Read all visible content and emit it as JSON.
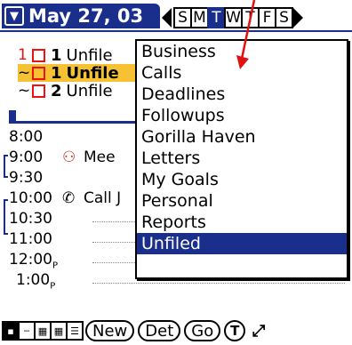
{
  "header": {
    "date": "May 27, 03",
    "week_days": [
      "S",
      "M",
      "T",
      "W",
      "T",
      "F",
      "S"
    ],
    "selected_day_index": 2
  },
  "todos": [
    {
      "priority": "1",
      "count": "1",
      "text": "Unfile",
      "highlighted": false
    },
    {
      "priority": "~",
      "count": "1",
      "text": "Unfile",
      "highlighted": true
    },
    {
      "priority": "~",
      "count": "2",
      "text": "Unfile",
      "highlighted": false
    }
  ],
  "schedule": [
    {
      "time": "8:00",
      "event": ""
    },
    {
      "time": "9:00",
      "event": "Mee"
    },
    {
      "time": "9:30",
      "event": ""
    },
    {
      "time": "10:00",
      "event": "Call J"
    },
    {
      "time": "10:30",
      "event": ""
    },
    {
      "time": "11:00",
      "event": ""
    },
    {
      "time": "12:00",
      "event": ""
    },
    {
      "time": "1:00",
      "event": ""
    }
  ],
  "time_suffix": "P",
  "category_menu": {
    "items": [
      "Business",
      "Calls",
      "Deadlines",
      "Followups",
      "Gorilla Haven",
      "Letters",
      "My Goals",
      "Personal",
      "Reports",
      "Unfiled"
    ],
    "selected": "Unfiled"
  },
  "toolbar": {
    "new_label": "New",
    "details_label": "Det",
    "go_label": "Go",
    "t_label": "T"
  },
  "colors": {
    "accent": "#1a2f8c",
    "highlight": "#f6c234",
    "priority_red": "#e11111"
  },
  "icons": {
    "date_tab": "down-arrow-box-icon",
    "meeting": "people-icon",
    "call": "phone-icon",
    "annotation": "red-arrow-icon"
  }
}
